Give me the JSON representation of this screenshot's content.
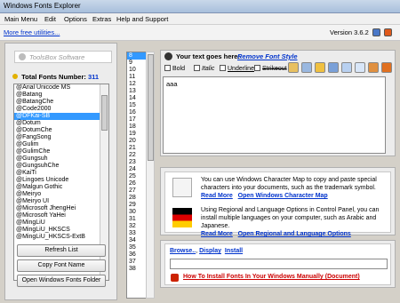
{
  "window": {
    "title": "Windows Fonts Explorer"
  },
  "menu": [
    "Main Menu",
    "Edit",
    "Options",
    "Extras",
    "Help and Support"
  ],
  "top": {
    "utilities_link": "More free utilities...",
    "version": "Version 3.6.2"
  },
  "left": {
    "logo_text": "ToolsBox Software",
    "total_label": "Total Fonts Number:",
    "total_value": "311",
    "fonts": [
      "@Arial Unicode MS",
      "@Batang",
      "@BatangChe",
      "@Code2000",
      "@DFKai-SB",
      "@Dotum",
      "@DotumChe",
      "@FangSong",
      "@Gulim",
      "@GulimChe",
      "@Gungsuh",
      "@GungsuhChe",
      "@KaiTi",
      "@Lingoes Unicode",
      "@Malgun Gothic",
      "@Meiryo",
      "@Meiryo UI",
      "@Microsoft JhengHei",
      "@Microsoft YaHei",
      "@MingLiU",
      "@MingLiU_HKSCS",
      "@MingLiU_HKSCS-ExtB"
    ],
    "selected_font": "@DFKai-SB",
    "buttons": {
      "refresh": "Refresh List",
      "copy": "Copy Font Name",
      "open_folder": "Open Windows Fonts Folder"
    }
  },
  "numbers": [
    "8",
    "9",
    "10",
    "11",
    "12",
    "13",
    "14",
    "15",
    "16",
    "17",
    "18",
    "19",
    "20",
    "21",
    "22",
    "23",
    "24",
    "25",
    "26",
    "27",
    "28",
    "29",
    "30",
    "31",
    "32",
    "33",
    "34",
    "35",
    "36",
    "37",
    "38"
  ],
  "text_panel": {
    "your_text_label": "Your text goes here:",
    "remove_style": "Remove Font Style",
    "bold": "Bold",
    "italic": "Italic",
    "underline": "Underline",
    "strikeout": "Strikeout",
    "sample_text": "aaa"
  },
  "info": {
    "charmap_text": "You can use Windows Character Map to copy and paste special characters into your documents, such as the trademark symbol.",
    "read_more": "Read More",
    "charmap_link": "Open Windows Character Map",
    "regional_text": "Using Regional and Language Options in Control Panel, you can install multiple languages on your computer, such as Arabic and Japanese.",
    "regional_link": "Open Regional and Language Options"
  },
  "install": {
    "browse": "Browse..",
    "display": "Display",
    "install": "Install",
    "howto": "How To Install Fonts In Your Windows Manually (Document)"
  }
}
